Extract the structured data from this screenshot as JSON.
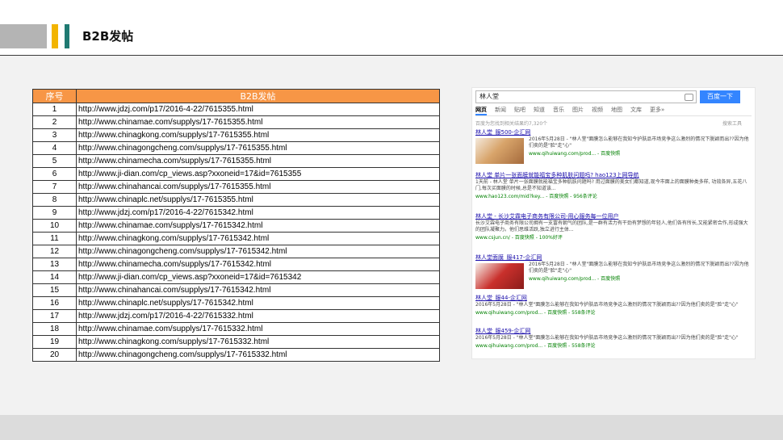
{
  "header": {
    "title": "B2B发帖"
  },
  "table": {
    "columns": [
      "序号",
      "B2B发帖"
    ],
    "rows": [
      {
        "no": "1",
        "url": "http://www.jdzj.com/p17/2016-4-22/7615355.html"
      },
      {
        "no": "2",
        "url": "http://www.chinamae.com/supplys/17-7615355.html"
      },
      {
        "no": "3",
        "url": "http://www.chinagkong.com/supplys/17-7615355.html"
      },
      {
        "no": "4",
        "url": "http://www.chinagongcheng.com/supplys/17-7615355.html"
      },
      {
        "no": "5",
        "url": "http://www.chinamecha.com/supplys/17-7615355.html"
      },
      {
        "no": "6",
        "url": "http://www.ji-dian.com/cp_views.asp?xxoneid=17&id=7615355"
      },
      {
        "no": "7",
        "url": "http://www.chinahancai.com/supplys/17-7615355.html"
      },
      {
        "no": "8",
        "url": "http://www.chinaplc.net/supplys/17-7615355.html"
      },
      {
        "no": "9",
        "url": "http://www.jdzj.com/p17/2016-4-22/7615342.html"
      },
      {
        "no": "10",
        "url": "http://www.chinamae.com/supplys/17-7615342.html"
      },
      {
        "no": "11",
        "url": "http://www.chinagkong.com/supplys/17-7615342.html"
      },
      {
        "no": "12",
        "url": "http://www.chinagongcheng.com/supplys/17-7615342.html"
      },
      {
        "no": "13",
        "url": "http://www.chinamecha.com/supplys/17-7615342.html"
      },
      {
        "no": "14",
        "url": "http://www.ji-dian.com/cp_views.asp?xxoneid=17&id=7615342"
      },
      {
        "no": "15",
        "url": "http://www.chinahancai.com/supplys/17-7615342.html"
      },
      {
        "no": "16",
        "url": "http://www.chinaplc.net/supplys/17-7615342.html"
      },
      {
        "no": "17",
        "url": "http://www.jdzj.com/p17/2016-4-22/7615332.html"
      },
      {
        "no": "18",
        "url": "http://www.chinamae.com/supplys/17-7615332.html"
      },
      {
        "no": "19",
        "url": "http://www.chinagkong.com/supplys/17-7615332.html"
      },
      {
        "no": "20",
        "url": "http://www.chinagongcheng.com/supplys/17-7615332.html"
      }
    ]
  },
  "serp": {
    "query": "林人堂",
    "search_button": "百度一下",
    "tabs": [
      "网页",
      "新闻",
      "贴吧",
      "知道",
      "音乐",
      "图片",
      "视频",
      "地图",
      "文库",
      "更多»"
    ],
    "result_count": "百度为您找到相关结果约7,320个",
    "tools": "搜索工具",
    "results": [
      {
        "title": "林人堂_服500-企汇网",
        "desc": "2016年5月28日 - \"林人堂\"面膜怎么能够在我知今护肤品市场竞争这么激烈的情况下脱颖而出??因为他们卖的是\"脸\"走\"心\"",
        "url": "www.qihuiwang.com/prod... - 百度快照"
      },
      {
        "title": "林人堂 单片一张面膜就能福宝多种肌肤问题吗? hao123上网导航",
        "desc": "1天前 - 林人堂 单片一张面膜就能福宝多种肌肤问题吗? 用过面膜的美女们都知道,现今市面上的面膜种类多样, 功效各异,五花八门,每次买面膜的时候,总是不知道该...",
        "url": "www.hao123.com/mid?key... - 百度快照 - 956条评论"
      },
      {
        "title": "林人堂 - 长沙艾霖电子商务有限公司-用心服务每一位用户",
        "desc": "长沙艾霖电子商务有限公司拥有一支富有朝气的团队,是一群有活力有干劲有梦想的年轻人,他们各有所长,又能紧密合作,形成强大的团队凝聚力。他们思维活跃,独立进行主体...",
        "url": "www.csjun.cn/ - 百度快照 - 100%好评"
      },
      {
        "title": "林人堂面膜_服417-企汇网",
        "desc": "2016年5月28日 - \"林人堂\"面膜怎么能够在我知今护肤品市场竞争这么激烈的情况下脱颖而出??因为他们卖的是\"脸\"走\"心\"",
        "url": "www.qihuiwang.com/prod... - 百度快照"
      },
      {
        "title": "林人堂_服44-企汇网",
        "desc": "2016年5月28日 - \"林人堂\"面膜怎么能够在我知今护肤品市场竞争这么激烈的情况下脱颖而出??因为他们卖的是\"脸\"走\"心\"",
        "url": "www.qihuiwang.com/prod... - 百度快照 - 558条评论"
      },
      {
        "title": "林人堂_服459-企汇网",
        "desc": "2016年5月28日 - \"林人堂\"面膜怎么能够在我知今护肤品市场竞争这么激烈的情况下脱颖而出??因为他们卖的是\"脸\"走\"心\"",
        "url": "www.qihuiwang.com/prod... - 百度快照 - 558条评论"
      }
    ]
  }
}
